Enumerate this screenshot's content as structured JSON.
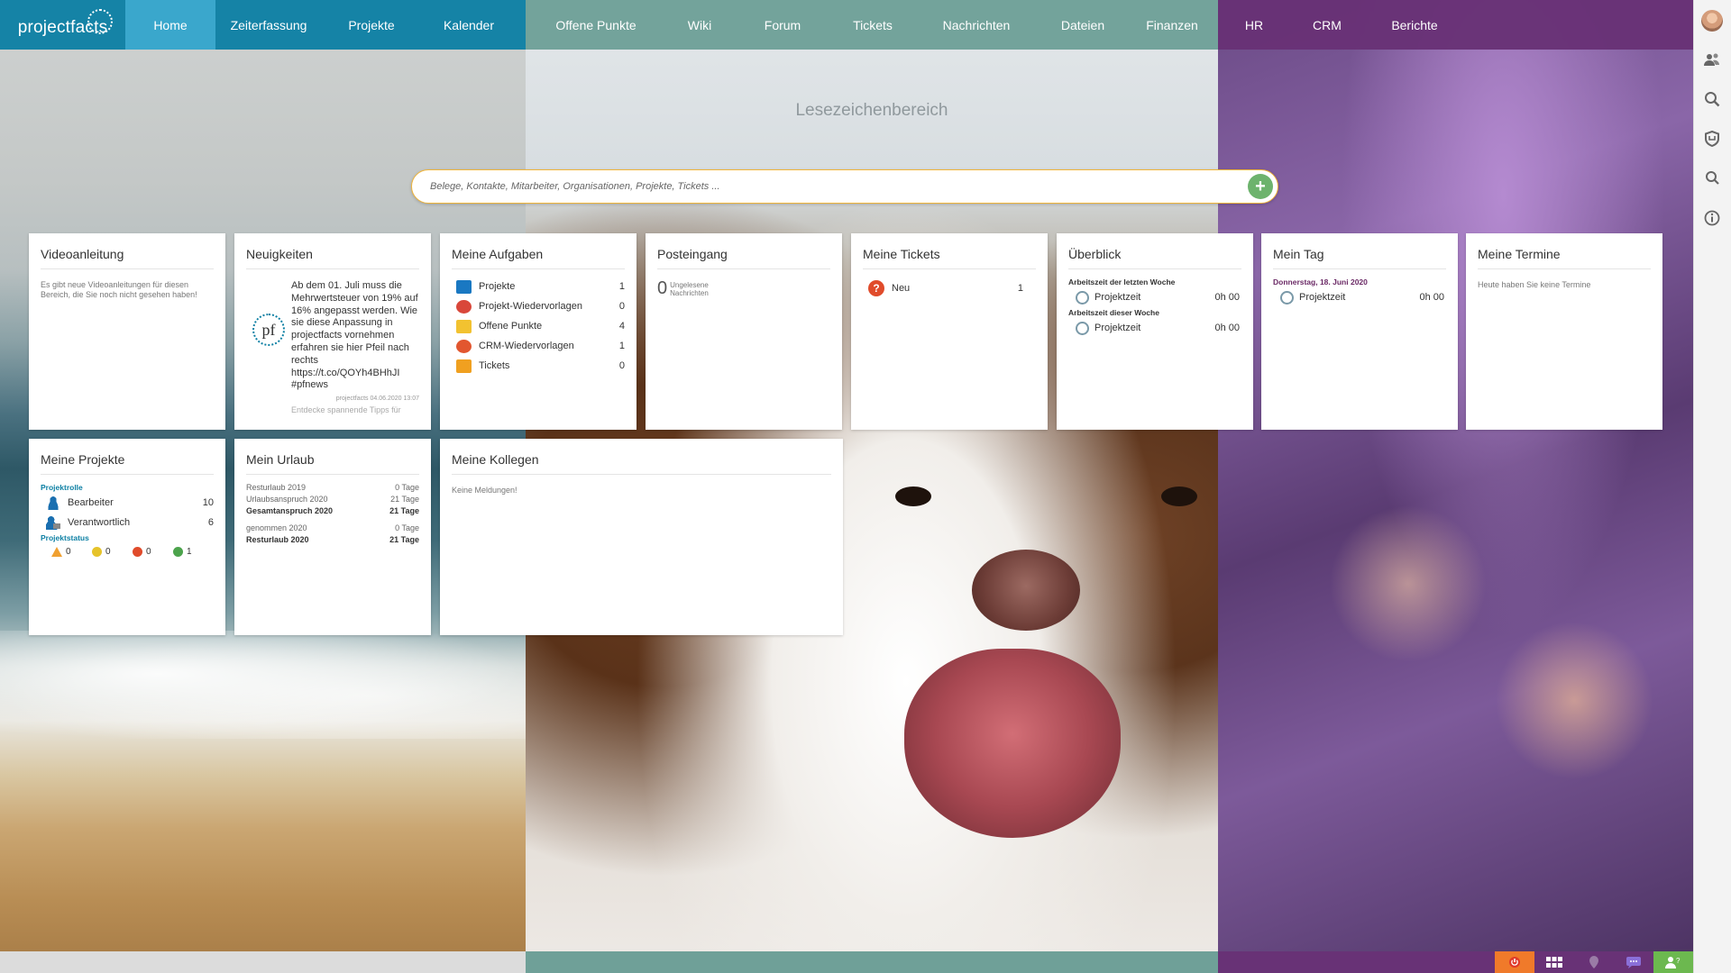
{
  "app": {
    "logo_text": "projectfacts"
  },
  "nav": {
    "blue": [
      {
        "label": "Home",
        "active": true
      },
      {
        "label": "Zeiterfassung"
      },
      {
        "label": "Projekte"
      },
      {
        "label": "Kalender"
      }
    ],
    "teal": [
      {
        "label": "Offene Punkte"
      },
      {
        "label": "Wiki"
      },
      {
        "label": "Forum"
      },
      {
        "label": "Tickets"
      },
      {
        "label": "Nachrichten"
      },
      {
        "label": "Dateien"
      },
      {
        "label": "Finanzen"
      }
    ],
    "purple": [
      {
        "label": "HR"
      },
      {
        "label": "CRM"
      },
      {
        "label": "Berichte"
      }
    ]
  },
  "bookmarks": {
    "label": "Lesezeichenbereich"
  },
  "search": {
    "placeholder": "Belege, Kontakte, Mitarbeiter, Organisationen, Projekte, Tickets ...",
    "add_icon": "+"
  },
  "widgets": {
    "video": {
      "title": "Videoanleitung",
      "text": "Es gibt neue Videoanleitungen für diesen Bereich, die Sie noch nicht gesehen haben!"
    },
    "news": {
      "title": "Neuigkeiten",
      "logo": "pf",
      "text": "Ab dem 01. Juli muss die Mehrwertsteuer von 19% auf 16% angepasst werden. Wie sie diese Anpassung in projectfacts vornehmen erfahren sie hier Pfeil nach rechts https://t.co/QOYh4BHhJI #pfnews",
      "meta": "projectfacts 04.06.2020 13:07",
      "next": "Entdecke spannende Tipps für"
    },
    "tasks": {
      "title": "Meine Aufgaben",
      "items": [
        {
          "label": "Projekte",
          "count": "1",
          "color": "#1a78c2"
        },
        {
          "label": "Projekt-Wiedervorlagen",
          "count": "0",
          "color": "#d9473a"
        },
        {
          "label": "Offene Punkte",
          "count": "4",
          "color": "#f2c230"
        },
        {
          "label": "CRM-Wiedervorlagen",
          "count": "1",
          "color": "#e2562f"
        },
        {
          "label": "Tickets",
          "count": "0",
          "color": "#f0a020"
        }
      ]
    },
    "inbox": {
      "title": "Posteingang",
      "count": "0",
      "label1": "Ungelesene",
      "label2": "Nachrichten"
    },
    "tickets": {
      "title": "Meine Tickets",
      "label": "Neu",
      "count": "1"
    },
    "overview": {
      "title": "Überblick",
      "last_week": "Arbeitszeit der letzten Woche",
      "this_week": "Arbeitszeit dieser Woche",
      "item": "Projektzeit",
      "last_value": "0h 00",
      "this_value": "0h 00"
    },
    "day": {
      "title": "Mein Tag",
      "date": "Donnerstag, 18. Juni 2020",
      "item": "Projektzeit",
      "value": "0h 00"
    },
    "appointments": {
      "title": "Meine Termine",
      "text": "Heute haben Sie keine Termine"
    },
    "projects": {
      "title": "Meine Projekte",
      "role_label": "Projektrolle",
      "roles": [
        {
          "label": "Bearbeiter",
          "count": "10"
        },
        {
          "label": "Verantwortlich",
          "count": "6"
        }
      ],
      "status_label": "Projektstatus",
      "status": [
        {
          "kind": "warning",
          "count": "0",
          "color": "#f0a030"
        },
        {
          "kind": "yellow",
          "count": "0",
          "color": "#e6c32a"
        },
        {
          "kind": "red",
          "count": "0",
          "color": "#e04b2b"
        },
        {
          "kind": "green",
          "count": "1",
          "color": "#4ca34c"
        }
      ]
    },
    "vacation": {
      "title": "Mein Urlaub",
      "rows": [
        {
          "k": "Resturlaub 2019",
          "v": "0 Tage",
          "bold": false
        },
        {
          "k": "Urlaubsanspruch 2020",
          "v": "21 Tage",
          "bold": false
        },
        {
          "k": "Gesamtanspruch 2020",
          "v": "21 Tage",
          "bold": true
        },
        {
          "k": "genommen 2020",
          "v": "0 Tage",
          "bold": false
        },
        {
          "k": "Resturlaub 2020",
          "v": "21 Tage",
          "bold": true
        }
      ]
    },
    "colleagues": {
      "title": "Meine Kollegen",
      "text": "Keine Meldungen!"
    }
  },
  "sidebar_icons": [
    "user-avatar",
    "users-icon",
    "search-icon",
    "shield-icon",
    "magnifier-icon",
    "info-icon"
  ],
  "bottom_buttons": [
    {
      "name": "power-icon",
      "bg": "#f07a2a"
    },
    {
      "name": "grid-icon",
      "bg": "#683276"
    },
    {
      "name": "pin-icon",
      "bg": "#683276"
    },
    {
      "name": "chat-icon",
      "bg": "#683276"
    },
    {
      "name": "help-user-icon",
      "bg": "#6cb84f"
    }
  ]
}
